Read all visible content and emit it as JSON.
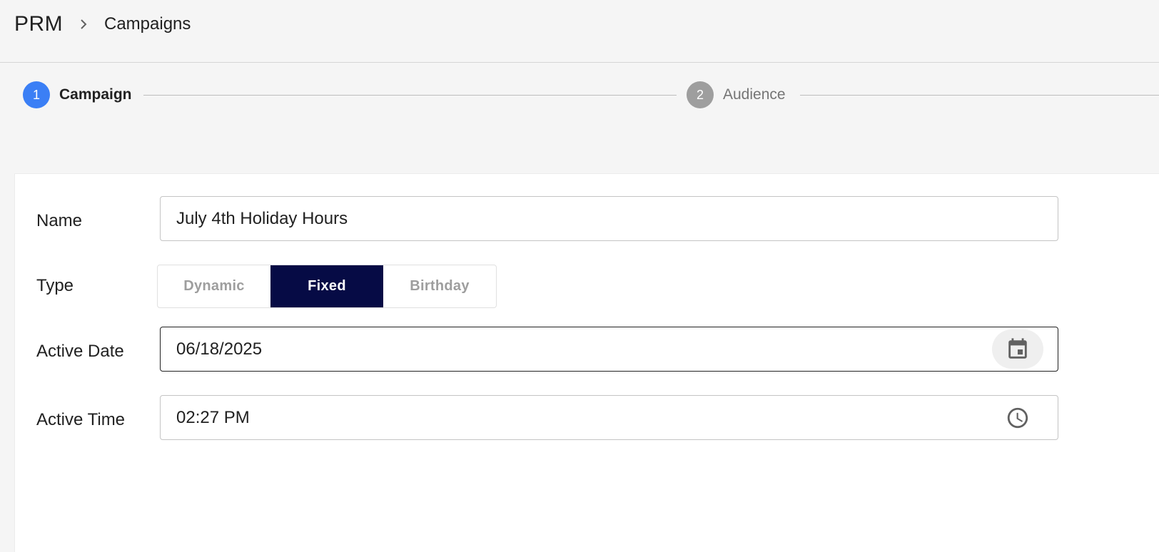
{
  "header": {
    "brand": "PRM",
    "breadcrumb_page": "Campaigns"
  },
  "stepper": {
    "steps": [
      {
        "number": "1",
        "label": "Campaign",
        "state": "active"
      },
      {
        "number": "2",
        "label": "Audience",
        "state": "inactive"
      }
    ]
  },
  "form": {
    "name": {
      "label": "Name",
      "value": "July 4th Holiday Hours"
    },
    "type": {
      "label": "Type",
      "options": [
        "Dynamic",
        "Fixed",
        "Birthday"
      ],
      "selected": "Fixed"
    },
    "active_date": {
      "label": "Active Date",
      "value": "06/18/2025",
      "icon": "calendar-icon"
    },
    "active_time": {
      "label": "Active Time",
      "value": "02:27 PM",
      "icon": "clock-icon"
    }
  },
  "colors": {
    "step_active": "#3b7ff5",
    "step_inactive": "#9e9e9e",
    "toggle_selected": "#060b45"
  }
}
